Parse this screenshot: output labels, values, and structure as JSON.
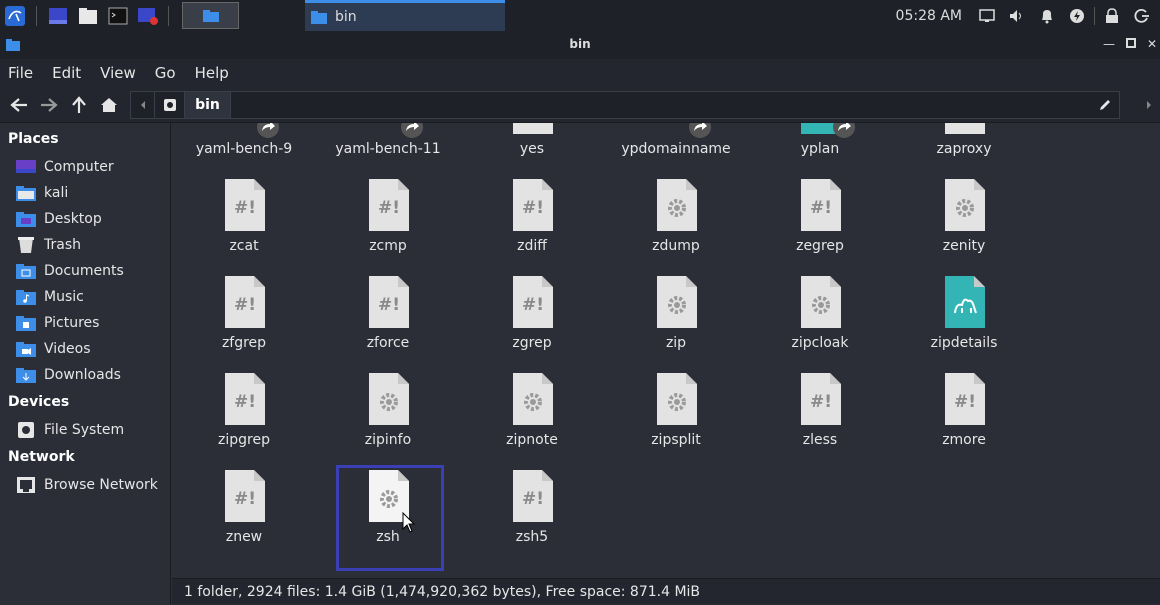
{
  "taskbar": {
    "task_label": "bin",
    "clock": "05:28 AM"
  },
  "window": {
    "title": "bin"
  },
  "menu": [
    "File",
    "Edit",
    "View",
    "Go",
    "Help"
  ],
  "path": {
    "crumb": "bin"
  },
  "sidebar": {
    "places_header": "Places",
    "places": [
      {
        "label": "Computer",
        "icon": "computer-icon"
      },
      {
        "label": "kali",
        "icon": "home-folder-icon"
      },
      {
        "label": "Desktop",
        "icon": "desktop-icon"
      },
      {
        "label": "Trash",
        "icon": "trash-icon"
      },
      {
        "label": "Documents",
        "icon": "documents-folder-icon"
      },
      {
        "label": "Music",
        "icon": "music-folder-icon"
      },
      {
        "label": "Pictures",
        "icon": "pictures-folder-icon"
      },
      {
        "label": "Videos",
        "icon": "videos-folder-icon"
      },
      {
        "label": "Downloads",
        "icon": "downloads-folder-icon"
      }
    ],
    "devices_header": "Devices",
    "devices": [
      {
        "label": "File System",
        "icon": "drive-icon"
      }
    ],
    "network_header": "Network",
    "network": [
      {
        "label": "Browse Network",
        "icon": "network-icon"
      }
    ]
  },
  "files": [
    {
      "name": "yaml-bench-9",
      "type": "binary-link"
    },
    {
      "name": "yaml-bench-11",
      "type": "binary-link"
    },
    {
      "name": "yes",
      "type": "binary"
    },
    {
      "name": "ypdomainname",
      "type": "binary-link"
    },
    {
      "name": "yplan",
      "type": "app-link"
    },
    {
      "name": "zaproxy",
      "type": "script"
    },
    {
      "name": "zcat",
      "type": "script"
    },
    {
      "name": "zcmp",
      "type": "script"
    },
    {
      "name": "zdiff",
      "type": "script"
    },
    {
      "name": "zdump",
      "type": "binary"
    },
    {
      "name": "zegrep",
      "type": "script"
    },
    {
      "name": "zenity",
      "type": "binary"
    },
    {
      "name": "zfgrep",
      "type": "script"
    },
    {
      "name": "zforce",
      "type": "script"
    },
    {
      "name": "zgrep",
      "type": "script"
    },
    {
      "name": "zip",
      "type": "binary"
    },
    {
      "name": "zipcloak",
      "type": "binary"
    },
    {
      "name": "zipdetails",
      "type": "perl"
    },
    {
      "name": "zipgrep",
      "type": "script"
    },
    {
      "name": "zipinfo",
      "type": "binary"
    },
    {
      "name": "zipnote",
      "type": "binary"
    },
    {
      "name": "zipsplit",
      "type": "binary"
    },
    {
      "name": "zless",
      "type": "script"
    },
    {
      "name": "zmore",
      "type": "script"
    },
    {
      "name": "znew",
      "type": "script"
    },
    {
      "name": "zsh",
      "type": "binary"
    },
    {
      "name": "zsh5",
      "type": "script"
    }
  ],
  "selected_file": "zsh",
  "status": "1 folder, 2924 files: 1.4 GiB (1,474,920,362 bytes), Free space: 871.4 MiB",
  "colors": {
    "accent": "#3d8ee8",
    "selection": "#3b3fb6",
    "perl_icon": "#34b5b5"
  }
}
